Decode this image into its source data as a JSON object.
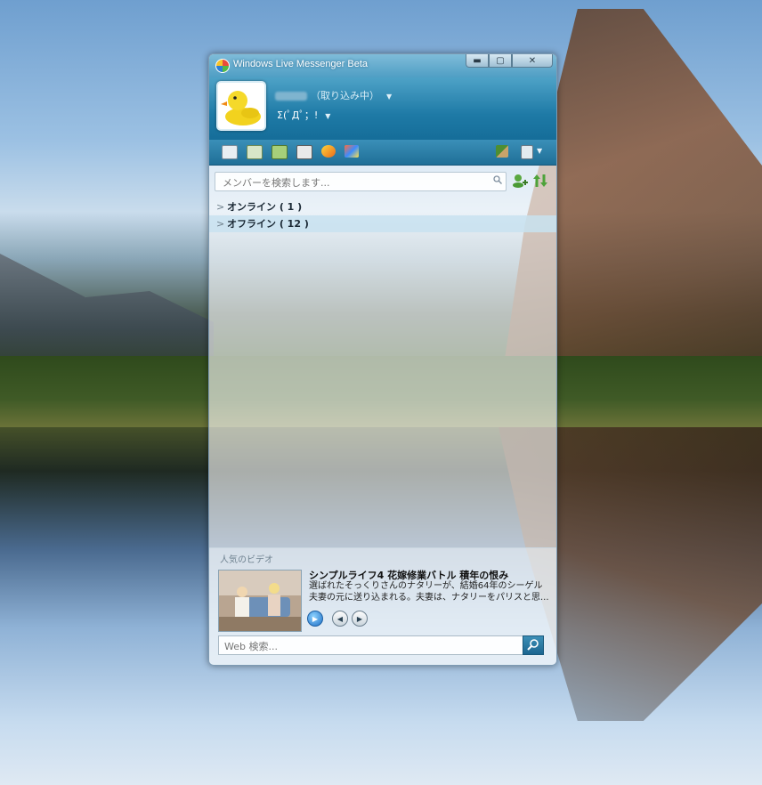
{
  "window": {
    "title": "Windows Live Messenger Beta",
    "min": "▬",
    "max": "▢",
    "close": "✕"
  },
  "profile": {
    "status": "（取り込み中）",
    "personal_message": "Σ(ﾟДﾟ；!"
  },
  "search": {
    "placeholder": "メンバーを検索します..."
  },
  "groups": [
    {
      "label": "オンライン ( 1 )"
    },
    {
      "label": "オフライン ( 12 )"
    }
  ],
  "video": {
    "heading": "人気のビデオ",
    "title": "シンプルライフ4 花嫁修業バトル 積年の恨み",
    "description": "選ばれたそっくりさんのナタリーが、結婚64年のシーゲル夫妻の元に送り込まれる。夫妻は、ナタリーをパリスと思..."
  },
  "web_search": {
    "placeholder": "Web 検索..."
  },
  "colors": {
    "accent": "#1e7aa6",
    "title_bar": "#4f9ec4"
  }
}
